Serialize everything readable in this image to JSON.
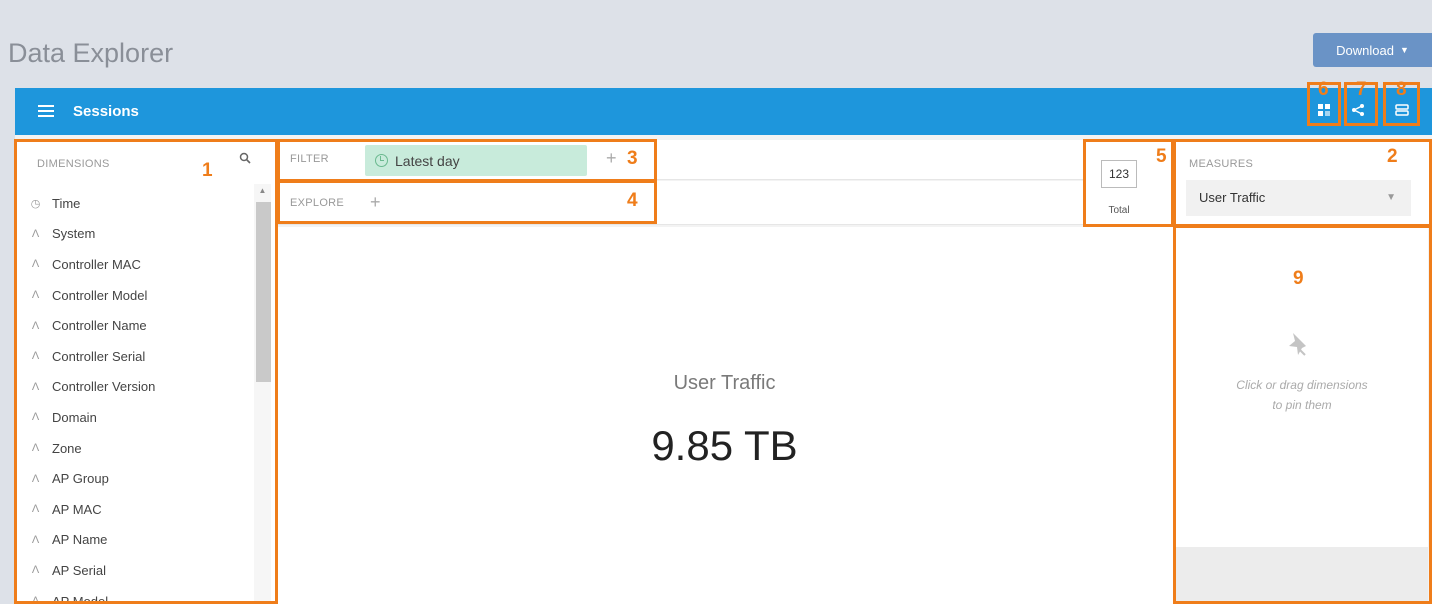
{
  "app": {
    "title": "Data Explorer",
    "download_label": "Download"
  },
  "topbar": {
    "title": "Sessions"
  },
  "dimensions": {
    "header": "DIMENSIONS",
    "items": [
      {
        "label": "Time",
        "icon": "clock-icon"
      },
      {
        "label": "System",
        "icon": "string-dimension-icon"
      },
      {
        "label": "Controller MAC",
        "icon": "string-dimension-icon"
      },
      {
        "label": "Controller Model",
        "icon": "string-dimension-icon"
      },
      {
        "label": "Controller Name",
        "icon": "string-dimension-icon"
      },
      {
        "label": "Controller Serial",
        "icon": "string-dimension-icon"
      },
      {
        "label": "Controller Version",
        "icon": "string-dimension-icon"
      },
      {
        "label": "Domain",
        "icon": "string-dimension-icon"
      },
      {
        "label": "Zone",
        "icon": "string-dimension-icon"
      },
      {
        "label": "AP Group",
        "icon": "string-dimension-icon"
      },
      {
        "label": "AP MAC",
        "icon": "string-dimension-icon"
      },
      {
        "label": "AP Name",
        "icon": "string-dimension-icon"
      },
      {
        "label": "AP Serial",
        "icon": "string-dimension-icon"
      },
      {
        "label": "AP Model",
        "icon": "string-dimension-icon"
      }
    ]
  },
  "filter": {
    "label": "FILTER",
    "chip": "Latest day",
    "add": "+"
  },
  "explore": {
    "label": "EXPLORE",
    "add": "+"
  },
  "total": {
    "icon_text": "123",
    "label": "Total"
  },
  "measures": {
    "header": "MEASURES",
    "selected": "User Traffic"
  },
  "visualization": {
    "measure_name": "User Traffic",
    "value": "9.85 TB"
  },
  "pinboard": {
    "hint_line1": "Click or drag dimensions",
    "hint_line2": "to pin them"
  },
  "callouts": [
    "1",
    "2",
    "3",
    "4",
    "5",
    "6",
    "7",
    "8",
    "9"
  ],
  "colors": {
    "accent": "#1e96dc",
    "callout": "#ef7d1a",
    "filter_chip": "#c8ebdb",
    "download": "#6a93c6"
  }
}
